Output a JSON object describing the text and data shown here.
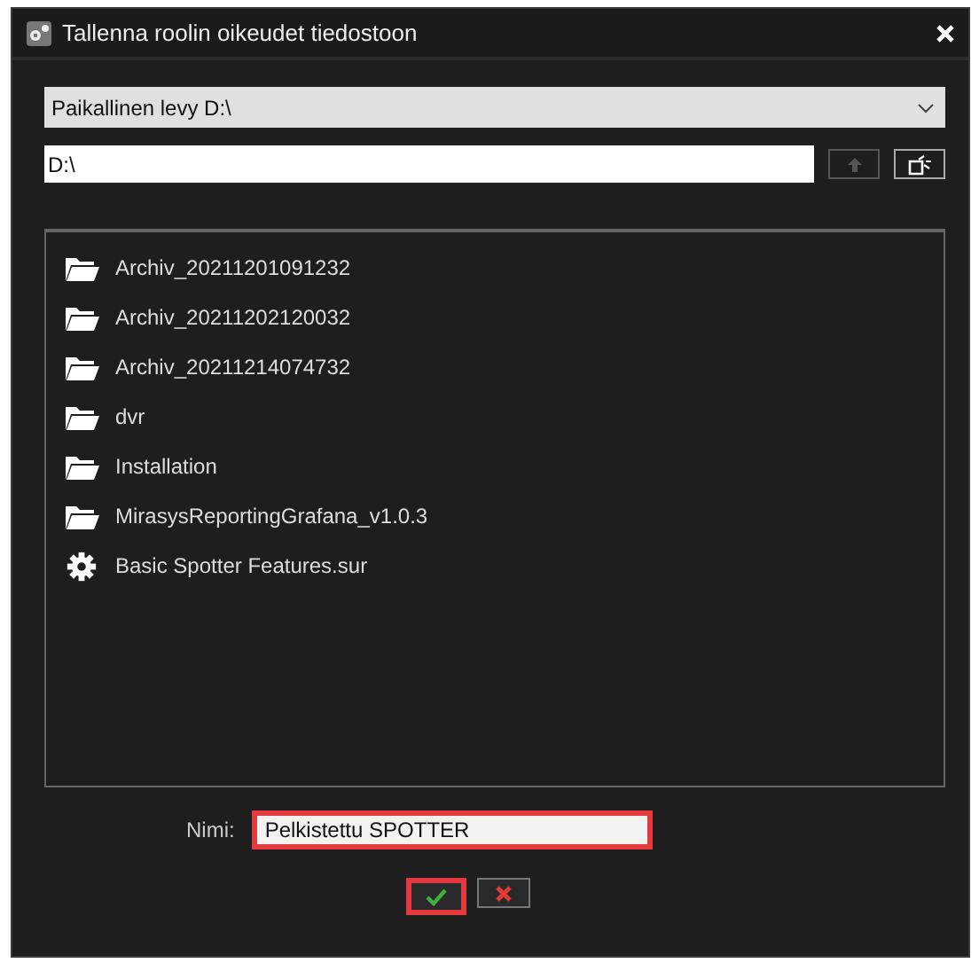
{
  "window": {
    "title": "Tallenna roolin oikeudet tiedostoon"
  },
  "drive_dropdown": {
    "value": "Paikallinen levy D:\\"
  },
  "path_field": {
    "value": "D:\\"
  },
  "up_button": {
    "disabled": true
  },
  "files": [
    {
      "name": "Archiv_20211201091232",
      "kind": "folder"
    },
    {
      "name": "Archiv_20211202120032",
      "kind": "folder"
    },
    {
      "name": "Archiv_20211214074732",
      "kind": "folder"
    },
    {
      "name": "dvr",
      "kind": "folder"
    },
    {
      "name": "Installation",
      "kind": "folder"
    },
    {
      "name": "MirasysReportingGrafana_v1.0.3",
      "kind": "folder"
    },
    {
      "name": "Basic Spotter Features.sur",
      "kind": "settings"
    }
  ],
  "name_field": {
    "label": "Nimi:",
    "value": "Pelkistettu SPOTTER",
    "highlighted": true
  },
  "ok_button": {
    "highlighted": true
  },
  "cancel_button": {
    "highlighted": false
  }
}
